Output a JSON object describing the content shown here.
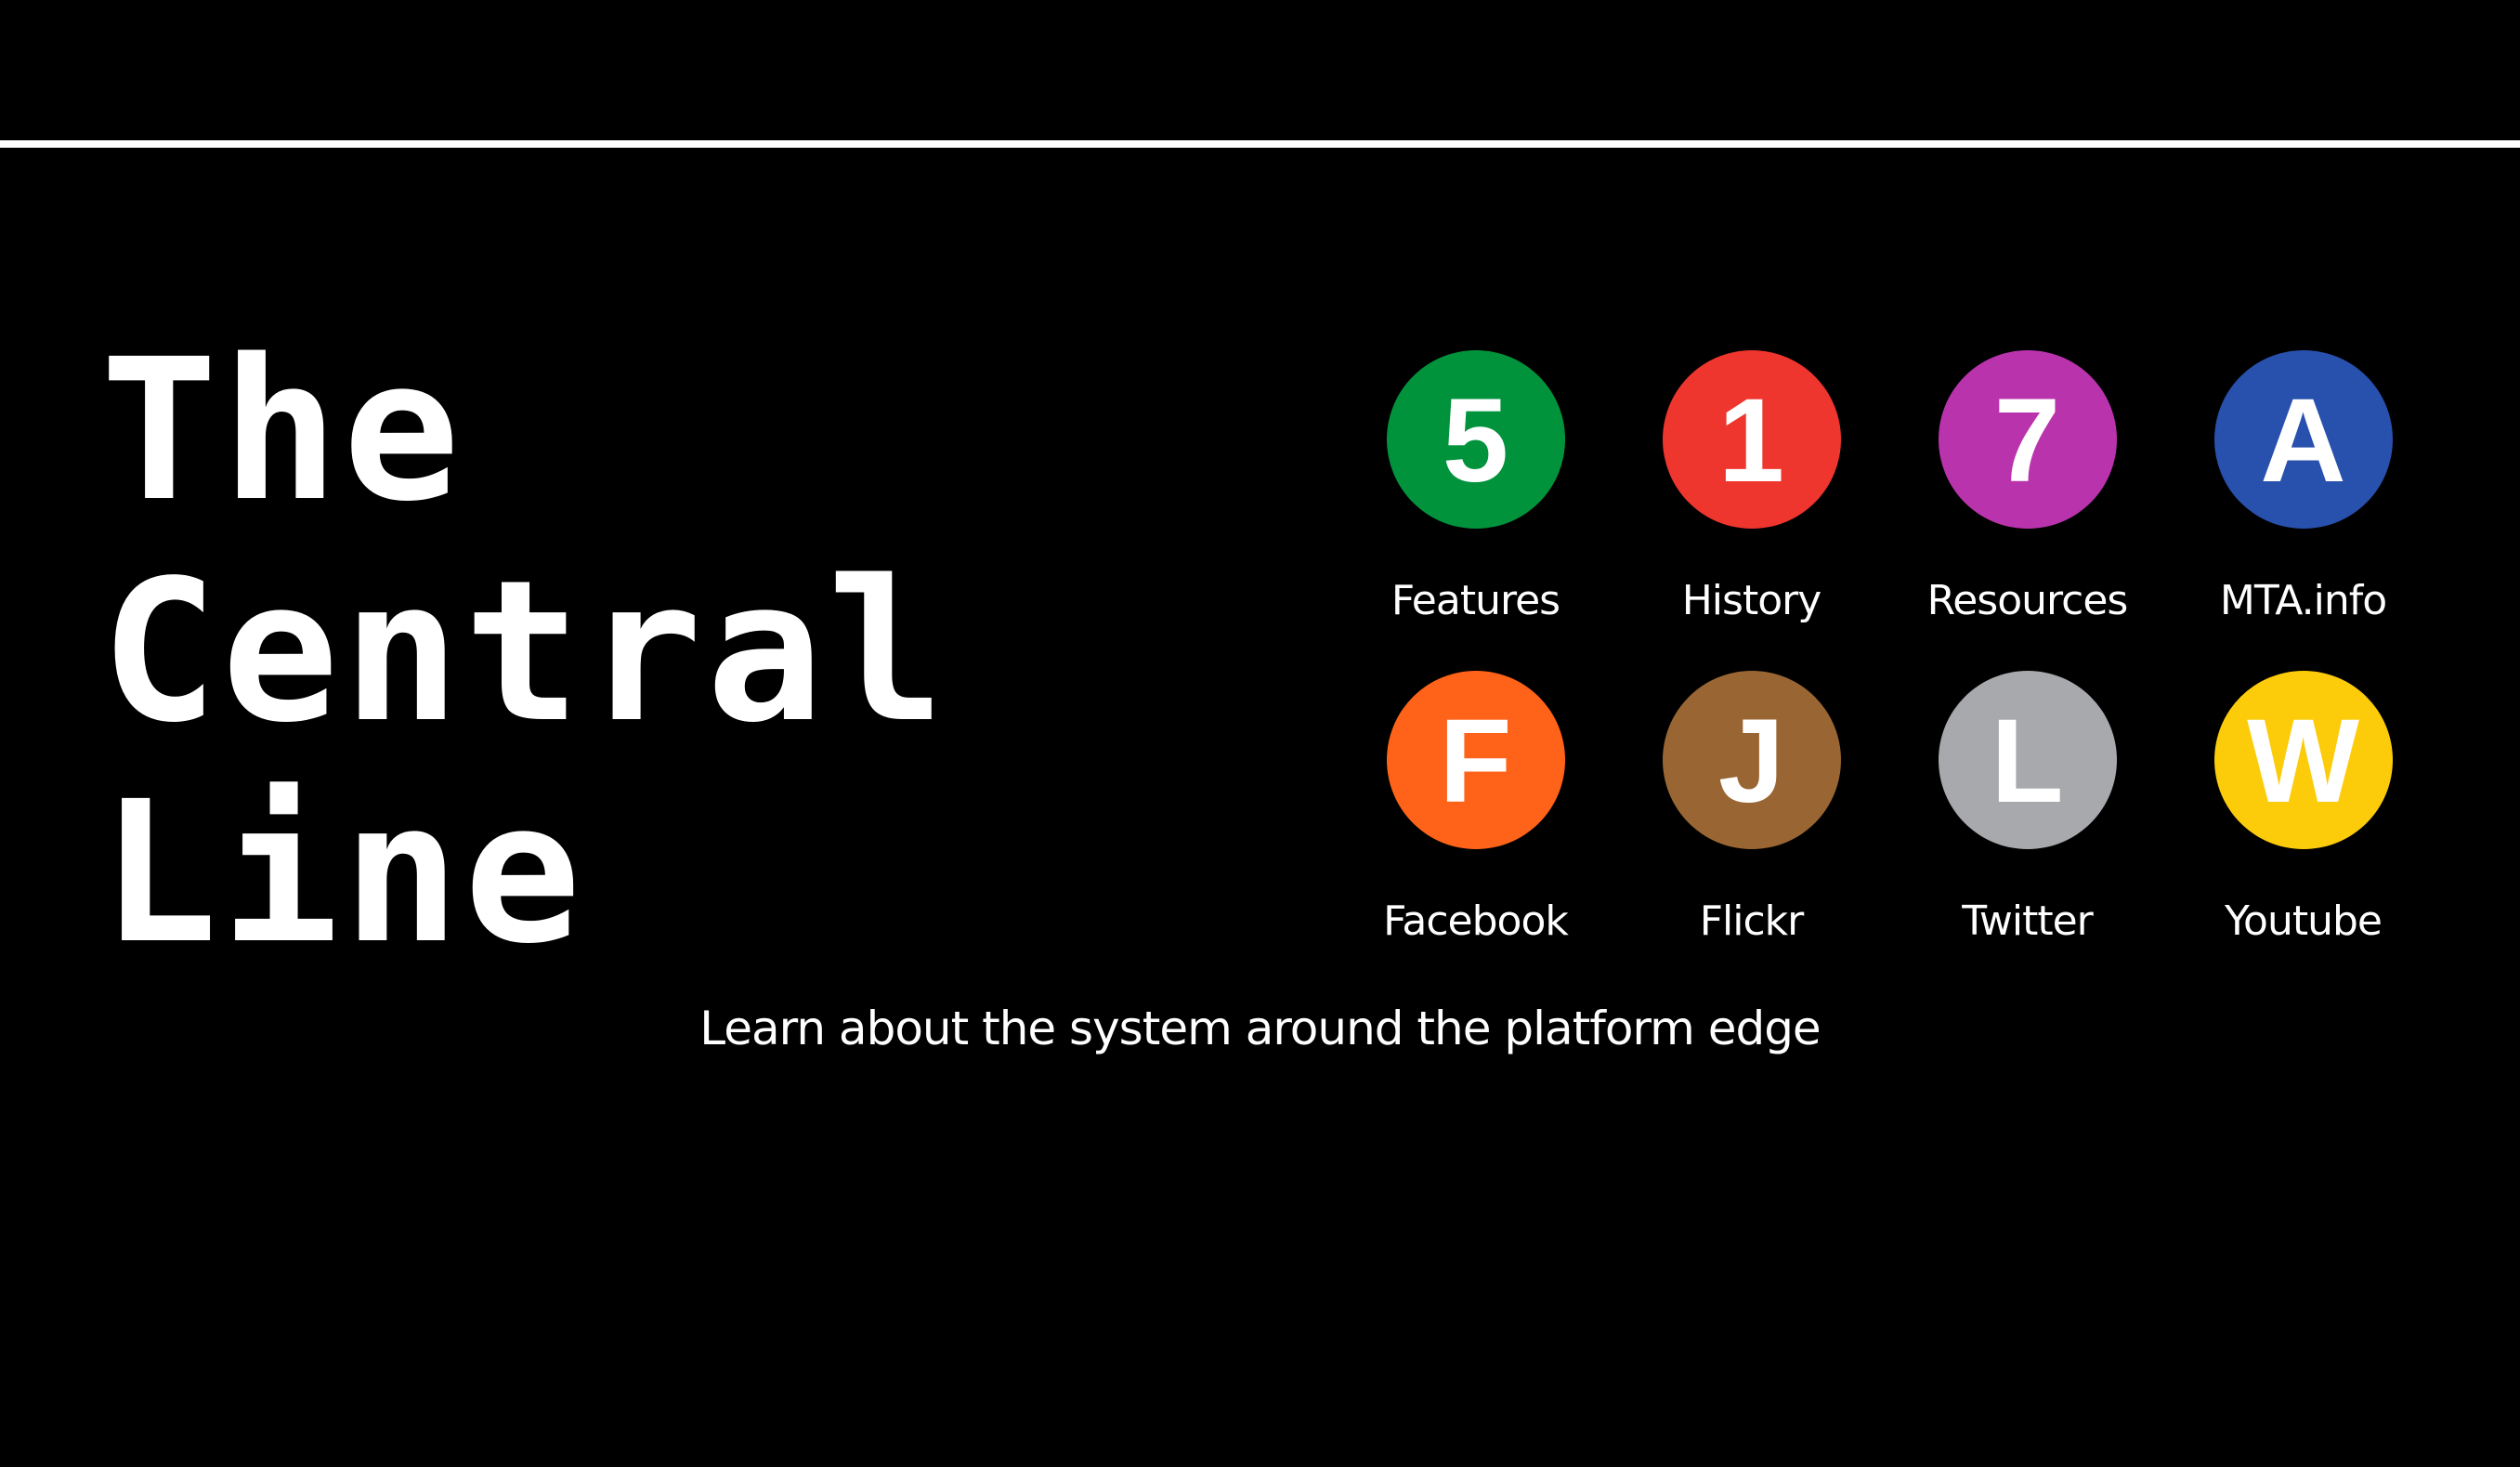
{
  "header": {
    "rule_color": "#ffffff"
  },
  "hero": {
    "title_lines": [
      "The",
      "Central",
      "Line"
    ]
  },
  "nav": {
    "items": [
      {
        "bullet": "5",
        "label": "Features",
        "color": "#00933c",
        "icon": "route-5-bullet-icon"
      },
      {
        "bullet": "1",
        "label": "History",
        "color": "#ee352e",
        "icon": "route-1-bullet-icon"
      },
      {
        "bullet": "7",
        "label": "Resources",
        "color": "#b933ad",
        "icon": "route-7-bullet-icon"
      },
      {
        "bullet": "A",
        "label": "MTA.info",
        "color": "#2850ad",
        "icon": "route-a-bullet-icon"
      },
      {
        "bullet": "F",
        "label": "Facebook",
        "color": "#ff6319",
        "icon": "route-f-bullet-icon"
      },
      {
        "bullet": "J",
        "label": "Flickr",
        "color": "#996633",
        "icon": "route-j-bullet-icon"
      },
      {
        "bullet": "L",
        "label": "Twitter",
        "color": "#a7a9ac",
        "icon": "route-l-bullet-icon"
      },
      {
        "bullet": "W",
        "label": "Youtube",
        "color": "#fccc0a",
        "icon": "route-w-bullet-icon"
      }
    ]
  },
  "tagline": "Learn about the system around the platform edge"
}
